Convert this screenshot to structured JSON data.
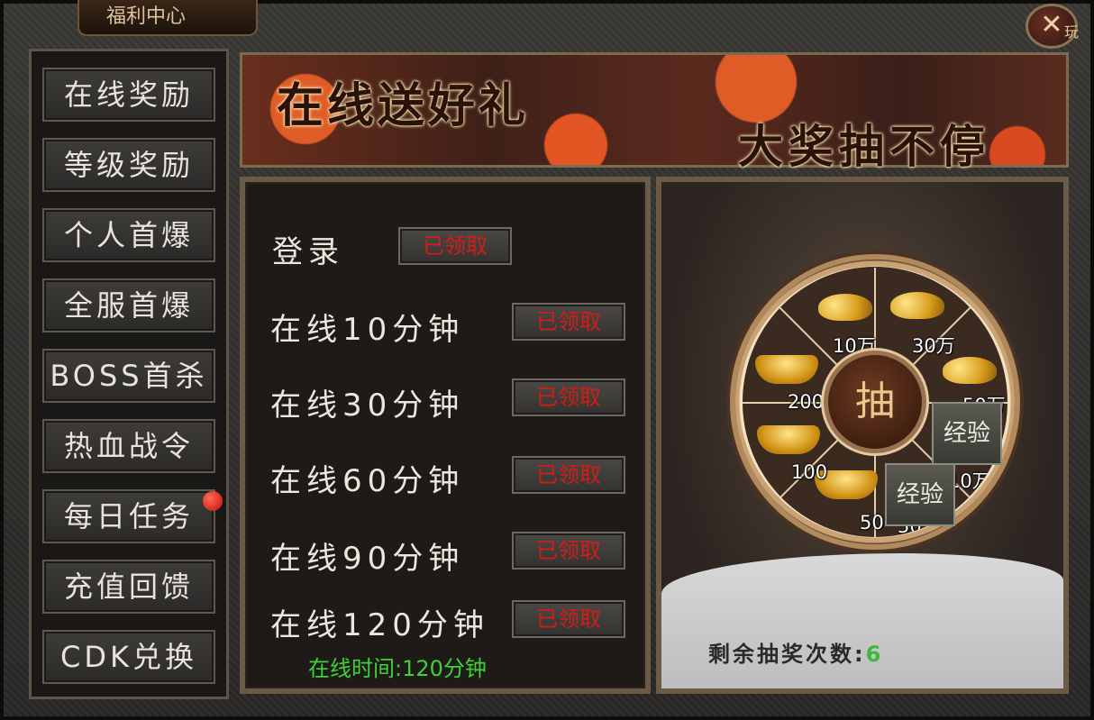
{
  "window": {
    "title": "福利中心",
    "close_symbol": "✕",
    "close_badge": "玩"
  },
  "sidebar": {
    "items": [
      {
        "label": "在线奖励"
      },
      {
        "label": "等级奖励"
      },
      {
        "label": "个人首爆"
      },
      {
        "label": "全服首爆"
      },
      {
        "label": "BOSS首杀"
      },
      {
        "label": "热血战令"
      },
      {
        "label": "每日任务",
        "badge": true
      },
      {
        "label": "充值回馈"
      },
      {
        "label": "CDK兑换"
      }
    ]
  },
  "banner": {
    "title": "在线送好礼",
    "subtitle": "大奖抽不停"
  },
  "rewards": {
    "rows": [
      {
        "label": "登录",
        "button": "已领取"
      },
      {
        "label": "在线10分钟",
        "button": "已领取"
      },
      {
        "label": "在线30分钟",
        "button": "已领取"
      },
      {
        "label": "在线60分钟",
        "button": "已领取"
      },
      {
        "label": "在线90分钟",
        "button": "已领取"
      },
      {
        "label": "在线120分钟",
        "button": "已领取"
      }
    ],
    "online_time": "在线时间:120分钟"
  },
  "lottery": {
    "draw_label": "抽",
    "prizes": [
      {
        "label": "10万",
        "icon": "gold-coins-icon"
      },
      {
        "label": "30万",
        "icon": "gold-coins-icon"
      },
      {
        "label": "50万",
        "icon": "gold-coins-icon"
      },
      {
        "label": "10万",
        "icon": "exp-icon",
        "icon_text": "经验"
      },
      {
        "label": "50万",
        "icon": "exp-icon",
        "icon_text": "经验"
      },
      {
        "label": "50",
        "icon": "gold-ingot-icon"
      },
      {
        "label": "100",
        "icon": "gold-ingot-icon"
      },
      {
        "label": "200",
        "icon": "gold-ingot-icon"
      }
    ],
    "remaining_label": "剩余抽奖次数:",
    "remaining_count": "6"
  },
  "colors": {
    "claimed": "#d21d17",
    "online_time": "#3fd13a",
    "remaining": "#3fb83a"
  }
}
